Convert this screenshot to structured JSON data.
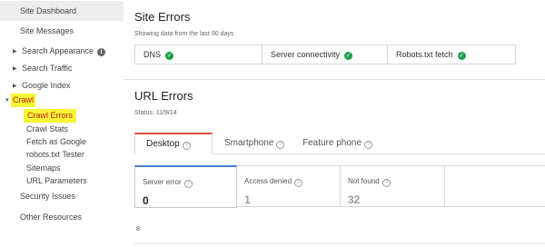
{
  "sidebar": {
    "dashboard": "Site Dashboard",
    "messages": "Site Messages",
    "search_appearance": "Search Appearance",
    "search_traffic": "Search Traffic",
    "google_index": "Google Index",
    "crawl": "Crawl",
    "crawl_items": [
      "Crawl Errors",
      "Crawl Stats",
      "Fetch as Google",
      "robots.txt Tester",
      "Sitemaps",
      "URL Parameters"
    ],
    "security": "Security Issues",
    "other": "Other Resources"
  },
  "site_errors": {
    "title": "Site Errors",
    "subtitle": "Showing data from the last 90 days",
    "items": [
      "DNS",
      "Server connectivity",
      "Robots.txt fetch"
    ]
  },
  "url_errors": {
    "title": "URL Errors",
    "status": "Status: 11/9/14",
    "tabs": [
      "Desktop",
      "Smartphone",
      "Feature phone"
    ],
    "stats": [
      {
        "label": "Server error",
        "value": "0"
      },
      {
        "label": "Access denied",
        "value": "1"
      },
      {
        "label": "Not found",
        "value": "32"
      }
    ],
    "chart_axis_label": "8"
  },
  "colors": {
    "highlight": "#f6f634",
    "active_nav_text": "#c41c1c",
    "ok_green": "#1e9e4a",
    "tab_accent": "#dd4b39",
    "stat_accent": "#4a7dd3"
  },
  "icons": {
    "info": "info-icon",
    "ok": "check-circle-icon",
    "help": "question-circle-icon",
    "expand": "triangle-right-icon",
    "collapse": "triangle-down-icon"
  }
}
